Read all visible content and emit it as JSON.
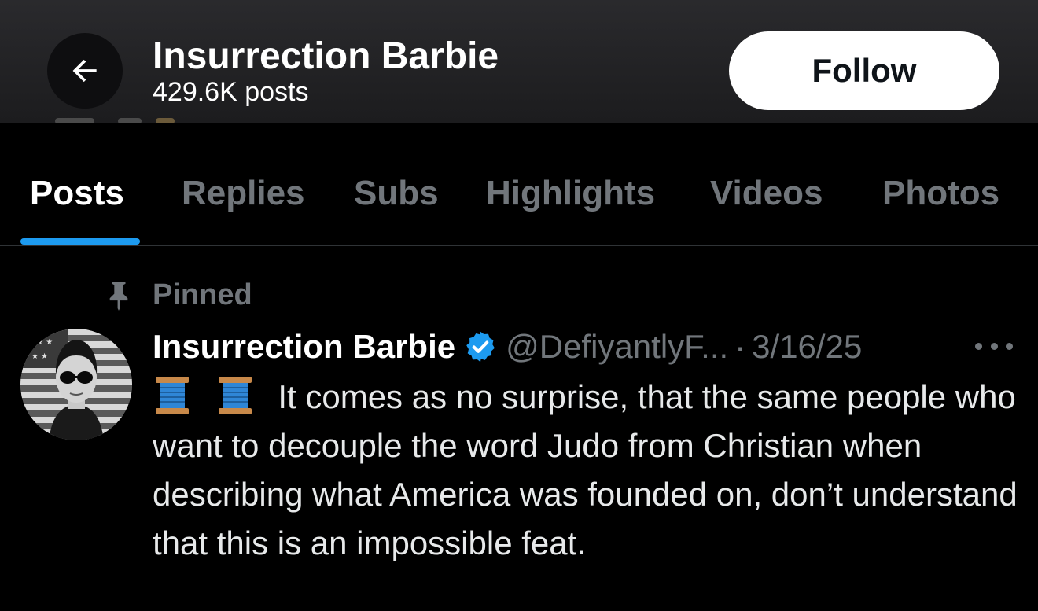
{
  "header": {
    "title": "Insurrection Barbie",
    "subtitle": "429.6K posts",
    "follow_label": "Follow",
    "back_icon": "arrow-left-icon"
  },
  "tabs": [
    {
      "label": "Posts",
      "active": true
    },
    {
      "label": "Replies",
      "active": false
    },
    {
      "label": "Subs",
      "active": false
    },
    {
      "label": "Highlights",
      "active": false
    },
    {
      "label": "Videos",
      "active": false
    },
    {
      "label": "Photos",
      "active": false
    }
  ],
  "post": {
    "pinned_label": "Pinned",
    "author": "Insurrection Barbie",
    "handle": "@DefiyantlyF...",
    "separator": "·",
    "date": "3/16/25",
    "text": "It comes as no surprise, that the same people who want to decouple the word Judo from Christian when describing what America was founded on, don’t understand that this is an impossible feat.",
    "emoji": [
      "spool-of-thread",
      "spool-of-thread"
    ]
  },
  "colors": {
    "accent": "#1d9bf0",
    "muted": "#71767b",
    "background": "#000000",
    "header_bg": "#1c1c1e"
  }
}
